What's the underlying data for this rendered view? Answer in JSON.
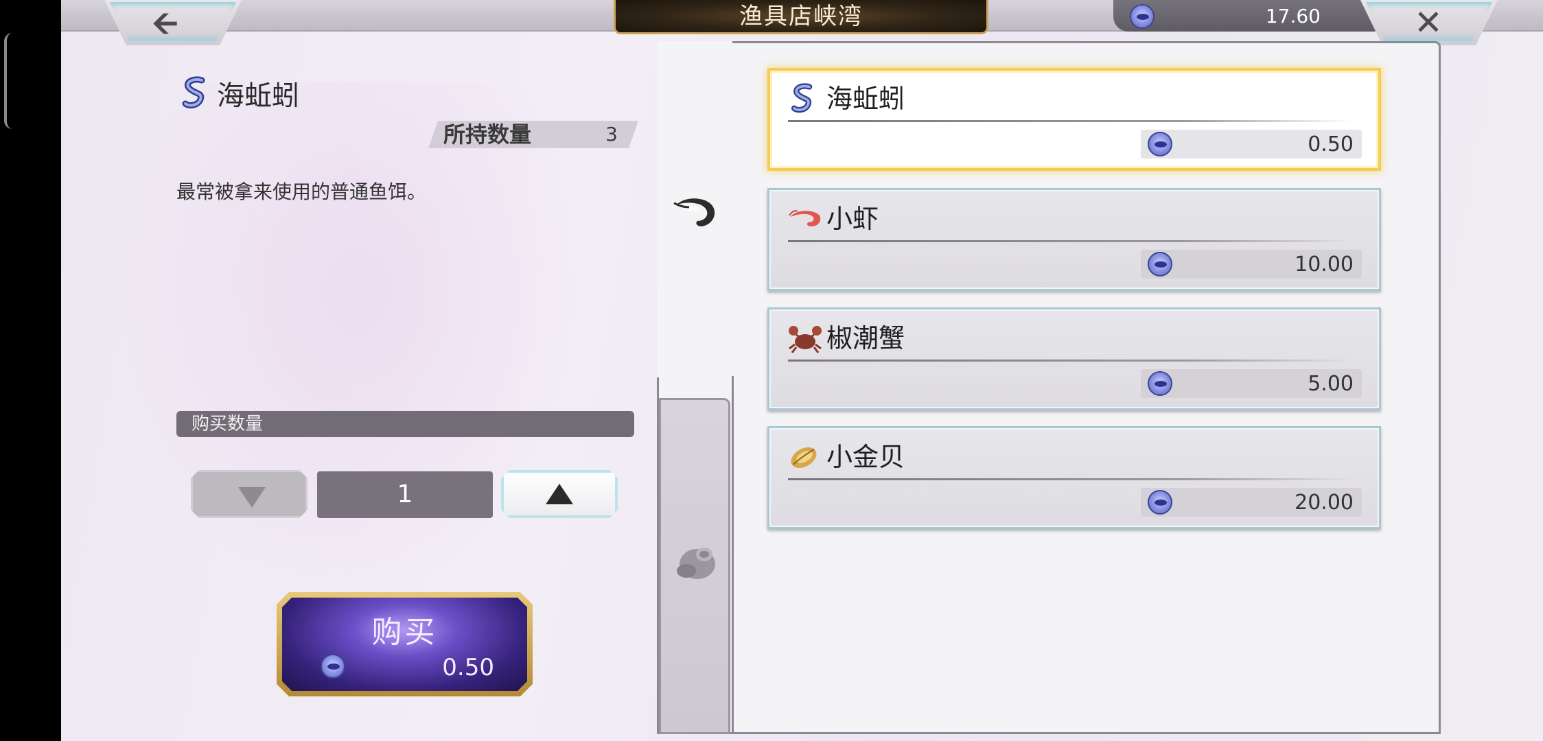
{
  "header": {
    "title": "渔具店峡湾",
    "currency_value": "17.60",
    "back_icon": "back-arrow-icon",
    "close_icon": "close-icon",
    "currency_icon": "fish-coin-icon"
  },
  "detail": {
    "item_name": "海蚯蚓",
    "item_icon": "worm-icon",
    "held_label": "所持数量",
    "held_count": "3",
    "description": "最常被拿来使用的普通鱼饵。",
    "quantity_label": "购买数量",
    "quantity": "1",
    "buy_label": "购买",
    "buy_price": "0.50"
  },
  "tabs": [
    {
      "icon": "shrimp-tab-icon",
      "active": true
    },
    {
      "icon": "pot-tab-icon",
      "active": false
    }
  ],
  "items": [
    {
      "name": "海蚯蚓",
      "price": "0.50",
      "icon": "worm-icon",
      "selected": true
    },
    {
      "name": "小虾",
      "price": "10.00",
      "icon": "shrimp-icon",
      "selected": false
    },
    {
      "name": "椒潮蟹",
      "price": "5.00",
      "icon": "crab-icon",
      "selected": false
    },
    {
      "name": "小金贝",
      "price": "20.00",
      "icon": "shell-icon",
      "selected": false
    }
  ],
  "colors": {
    "selected_border": "#f3cd55",
    "buy_button": "#6a4fc8",
    "title_plate": "#2f2416"
  }
}
